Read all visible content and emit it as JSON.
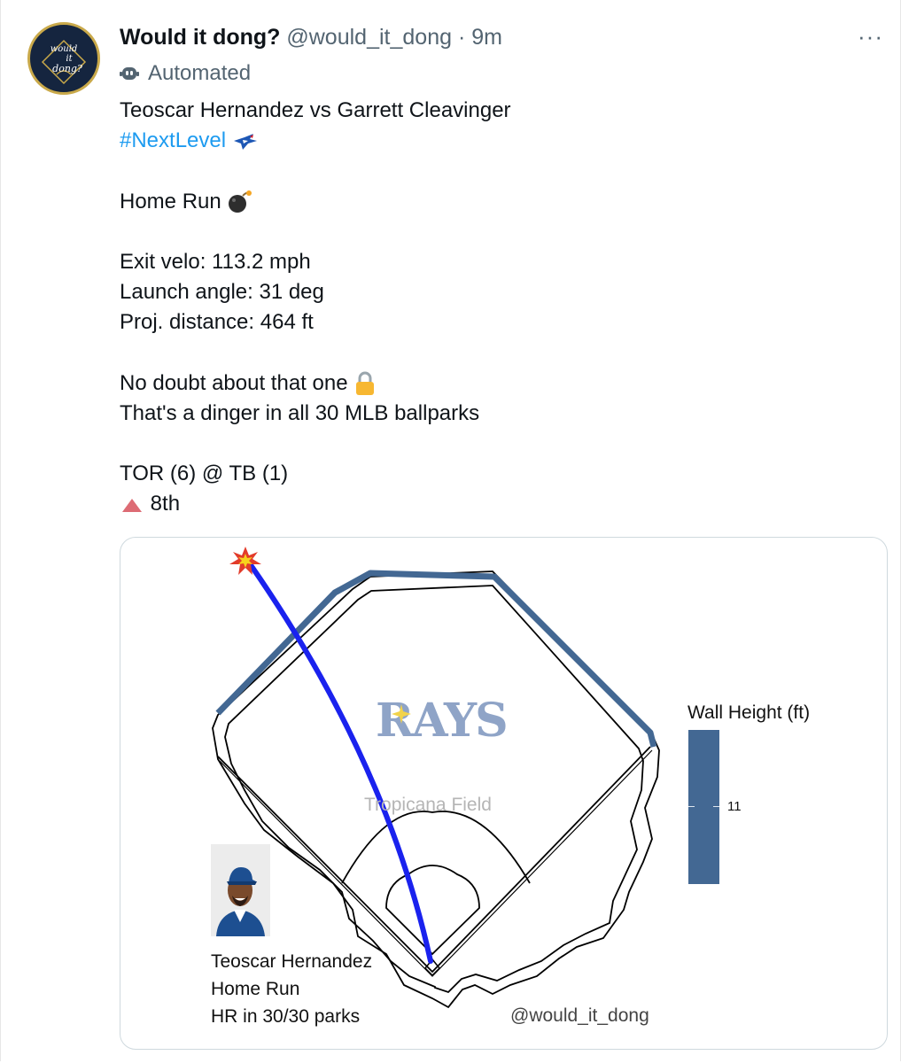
{
  "account": {
    "display_name": "Would it dong?",
    "handle": "@would_it_dong",
    "separator": "·",
    "time": "9m",
    "avatar_text": [
      "would",
      "it",
      "dong?"
    ],
    "automated_label": "Automated"
  },
  "menu": {
    "more_label": "···"
  },
  "tweet": {
    "matchup": "Teoscar Hernandez vs Garrett Cleavinger",
    "hashtag": "#NextLevel",
    "result": "Home Run",
    "exit_velo": "Exit velo: 113.2 mph",
    "launch_angle": "Launch angle: 31 deg",
    "proj_distance": "Proj. distance: 464 ft",
    "verdict": "No doubt about that one",
    "ballparks": "That's a dinger in all 30 MLB ballparks",
    "score": "TOR (6) @ TB (1)",
    "inning": "8th"
  },
  "card": {
    "logo_text": "RAYS",
    "park_name": "Tropicana Field",
    "player_name": "Teoscar Hernandez",
    "result": "Home Run",
    "parks": "HR in 30/30 parks",
    "watermark": "@would_it_dong",
    "legend_title": "Wall Height (ft)",
    "legend_value": "11",
    "wall_color": "#436893",
    "trajectory_color": "#1a22ee"
  },
  "colors": {
    "hashtag": "#1d9bf0",
    "secondary_text": "#536471",
    "avatar_bg": "#15253f",
    "avatar_gold": "#c9a94a"
  }
}
